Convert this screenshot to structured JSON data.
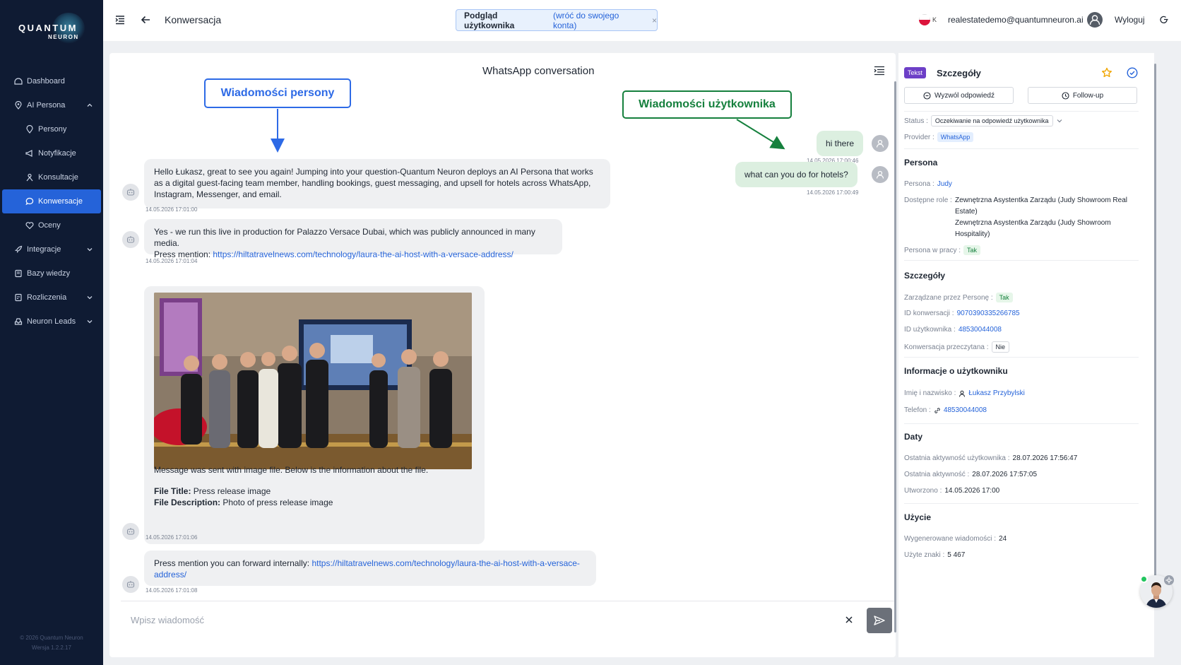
{
  "brand": {
    "line1": "QUANTUM",
    "line2": "NEURON",
    "copyright": "© 2026 Quantum Neuron",
    "version": "Wersja 1.2.2.17"
  },
  "sidebar": {
    "items": [
      {
        "label": "Dashboard",
        "icon": "dashboard-icon"
      },
      {
        "label": "AI Persona",
        "icon": "location-icon"
      },
      {
        "label": "Persony",
        "icon": "location-icon"
      },
      {
        "label": "Notyfikacje",
        "icon": "megaphone-icon"
      },
      {
        "label": "Konsultacje",
        "icon": "person-icon"
      },
      {
        "label": "Konwersacje",
        "icon": "chat-icon"
      },
      {
        "label": "Oceny",
        "icon": "heart-icon"
      },
      {
        "label": "Integracje",
        "icon": "rocket-icon"
      },
      {
        "label": "Bazy wiedzy",
        "icon": "book-icon"
      },
      {
        "label": "Rozliczenia",
        "icon": "billing-icon"
      },
      {
        "label": "Neuron Leads",
        "icon": "inbox-icon"
      }
    ]
  },
  "header": {
    "title": "Konwersacja",
    "preview_bold": "Podgląd użytkownika",
    "preview_link": "(wróć do swojego konta)",
    "preview_close": "×",
    "lang_code": "K",
    "email": "realestatedemo@quantumneuron.ai",
    "logout": "Wyloguj"
  },
  "chat": {
    "title": "WhatsApp conversation",
    "callout_persona": "Wiadomości persony",
    "callout_user": "Wiadomości użytkownika",
    "user_messages": [
      {
        "text": "hi there",
        "time": "14.05.2026 17:00:46"
      },
      {
        "text": "what can you do for hotels?",
        "time": "14.05.2026 17:00:49"
      }
    ],
    "bot_messages": [
      {
        "text": "Hello Łukasz, great to see you again! Jumping into your question-Quantum Neuron deploys an AI Persona that works as a digital guest-facing team member, handling bookings, guest messaging, and upsell for hotels across WhatsApp, Instagram, Messenger, and email.",
        "time": "14.05.2026 17:01:00"
      },
      {
        "text": "Yes - we run this live in production for Palazzo Versace Dubai, which was publicly announced in many media.",
        "text2": "Press mention: ",
        "link": "https://hiltatravelnews.com/technology/laura-the-ai-host-with-a-versace-address/",
        "time": "14.05.2026 17:01:04"
      },
      {
        "text": "Message was sent with image file. Below is the information about the file.",
        "file_title_label": "File Title:",
        "file_title": " Press release image",
        "file_desc_label": "File Description:",
        "file_desc": " Photo of press release image",
        "time": "14.05.2026 17:01:06"
      },
      {
        "text": "Press mention you can forward internally: ",
        "link": "https://hiltatravelnews.com/technology/laura-the-ai-host-with-a-versace-address/",
        "time": "14.05.2026 17:01:08"
      }
    ],
    "composer_placeholder": "Wpisz wiadomość"
  },
  "details": {
    "tag": "Tekst",
    "title": "Szczegóły",
    "btn_trigger": "Wyzwól odpowiedź",
    "btn_followup": "Follow-up",
    "status_label": "Status :",
    "status_value": "Oczekiwanie na odpowiedź użytkownika",
    "provider_label": "Provider :",
    "provider_value": "WhatsApp",
    "persona_h": "Persona",
    "persona_label": "Persona :",
    "persona_value": "Judy",
    "roles_label": "Dostępne role :",
    "role1": "Zewnętrzna Asystentka Zarządu (Judy Showroom Real Estate)",
    "role2": "Zewnętrzna Asystentka Zarządu (Judy Showroom Hospitality)",
    "working_label": "Persona w pracy :",
    "working_value": "Tak",
    "szcz_h": "Szczegóły",
    "managed_label": "Zarządzane przez Personę :",
    "managed_value": "Tak",
    "conv_id_label": "ID konwersacji :",
    "conv_id_value": "9070390335266785",
    "user_id_label": "ID użytkownika :",
    "user_id_value": "48530044008",
    "read_label": "Konwersacja przeczytana :",
    "read_value": "Nie",
    "userinfo_h": "Informacje o użytkowniku",
    "name_label": "Imię i nazwisko :",
    "name_value": "Łukasz Przybylski",
    "phone_label": "Telefon :",
    "phone_value": "48530044008",
    "dates_h": "Daty",
    "last_user_label": "Ostatnia aktywność użytkownika :",
    "last_user_value": "28.07.2026 17:56:47",
    "last_label": "Ostatnia aktywność :",
    "last_value": "28.07.2026 17:57:05",
    "created_label": "Utworzono :",
    "created_value": "14.05.2026 17:00",
    "usage_h": "Użycie",
    "gen_label": "Wygenerowane wiadomości :",
    "gen_value": "24",
    "chars_label": "Użyte znaki :",
    "chars_value": "5 467"
  },
  "colors": {
    "sidebar": "#0f1b33",
    "accent": "#2563d9",
    "persona_callout": "#2d6ae6",
    "user_callout": "#15803d",
    "user_bubble": "#dcefe0",
    "bot_bubble": "#eff0f2"
  }
}
